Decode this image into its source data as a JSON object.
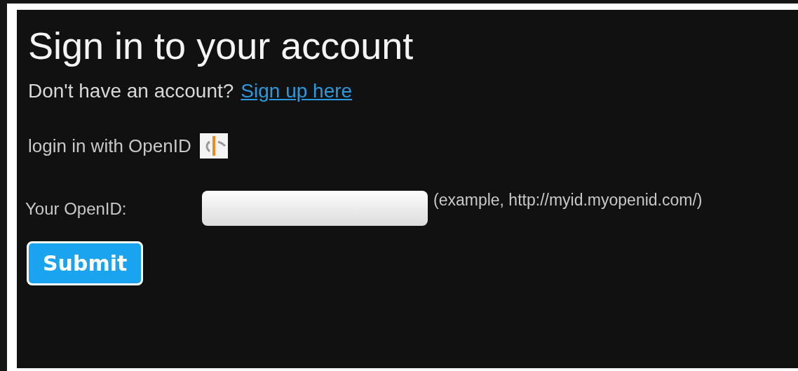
{
  "title": "Sign in to your account",
  "signup_prompt": {
    "text": "Don't have an account?",
    "link": "Sign up here"
  },
  "openid_heading": "login in with OpenID",
  "openid_field": {
    "label": "Your OpenID:",
    "hint": "(example, http://myid.myopenid.com/)"
  },
  "submit_button": "Submit"
}
